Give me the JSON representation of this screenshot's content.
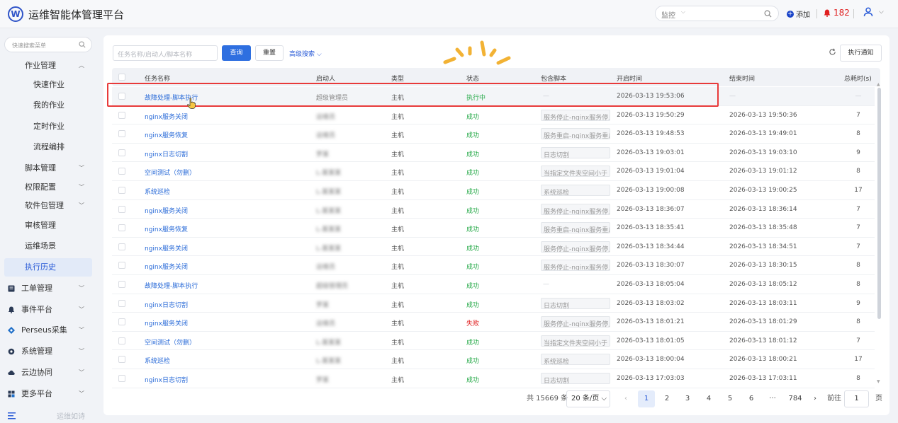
{
  "app": {
    "logo": "W",
    "title": "运维智能体管理平台"
  },
  "topbar": {
    "monitor_select": "监控",
    "search_placeholder": "",
    "add_label": "添加",
    "alarm_count": "182"
  },
  "sidebar": {
    "search_placeholder": "快速搜索菜单",
    "items": [
      {
        "label": "作业管理",
        "arrow": "^"
      },
      {
        "label": "快速作业"
      },
      {
        "label": "我的作业"
      },
      {
        "label": "定时作业"
      },
      {
        "label": "流程编排"
      },
      {
        "label": "脚本管理",
        "arrow": "v"
      },
      {
        "label": "权限配置",
        "arrow": "v"
      },
      {
        "label": "软件包管理",
        "arrow": "v"
      },
      {
        "label": "审核管理"
      },
      {
        "label": "运维场景"
      },
      {
        "label": "执行历史"
      },
      {
        "label": "工单管理",
        "arrow": "v"
      },
      {
        "label": "事件平台",
        "arrow": "v"
      },
      {
        "label": "Perseus采集",
        "arrow": "v"
      },
      {
        "label": "系统管理",
        "arrow": "v"
      },
      {
        "label": "云边协同",
        "arrow": "v"
      },
      {
        "label": "更多平台",
        "arrow": "v"
      }
    ],
    "footer_text": "运维如诗"
  },
  "filter": {
    "input_placeholder": "任务名称/启动人/脚本名称",
    "query_label": "查询",
    "reset_label": "重置",
    "advanced_label": "高级搜索",
    "notify_label": "执行通知"
  },
  "table": {
    "columns": [
      "任务名称",
      "启动人",
      "类型",
      "状态",
      "包含脚本",
      "开启时间",
      "结束时间",
      "总耗时(s)"
    ],
    "rows": [
      {
        "name": "故障处理-脚本执行",
        "starter": "超级管理员",
        "blur": false,
        "type": "主机",
        "status": "执行中",
        "status_color": "#22a845",
        "script": "—",
        "start": "2026-03-13 19:53:06",
        "end": "—",
        "dur": "—"
      },
      {
        "name": "nginx服务关闭",
        "starter": "运维员",
        "blur": true,
        "type": "主机",
        "status": "成功",
        "status_color": "#22a845",
        "script": "服务停止-nginx服务停止",
        "start": "2026-03-13 19:50:29",
        "end": "2026-03-13 19:50:36",
        "dur": "7"
      },
      {
        "name": "nginx服务恢复",
        "starter": "运维员",
        "blur": true,
        "type": "主机",
        "status": "成功",
        "status_color": "#22a845",
        "script": "服务重启-nginx服务重启",
        "start": "2026-03-13 19:48:53",
        "end": "2026-03-13 19:49:01",
        "dur": "8"
      },
      {
        "name": "nginx日志切割",
        "starter": "罗某",
        "blur": true,
        "type": "主机",
        "status": "成功",
        "status_color": "#22a845",
        "script": "日志切割",
        "start": "2026-03-13 19:03:01",
        "end": "2026-03-13 19:03:10",
        "dur": "9"
      },
      {
        "name": "空间测试（勿删）",
        "starter": "L-某某某",
        "blur": true,
        "type": "主机",
        "status": "成功",
        "status_color": "#22a845",
        "script": "当指定文件夹空间小于",
        "start": "2026-03-13 19:01:04",
        "end": "2026-03-13 19:01:12",
        "dur": "8"
      },
      {
        "name": "系统巡检",
        "starter": "L-某某某",
        "blur": true,
        "type": "主机",
        "status": "成功",
        "status_color": "#22a845",
        "script": "系统巡检",
        "start": "2026-03-13 19:00:08",
        "end": "2026-03-13 19:00:25",
        "dur": "17"
      },
      {
        "name": "nginx服务关闭",
        "starter": "L-某某某",
        "blur": true,
        "type": "主机",
        "status": "成功",
        "status_color": "#22a845",
        "script": "服务停止-nginx服务停止",
        "start": "2026-03-13 18:36:07",
        "end": "2026-03-13 18:36:14",
        "dur": "7"
      },
      {
        "name": "nginx服务恢复",
        "starter": "L-某某某",
        "blur": true,
        "type": "主机",
        "status": "成功",
        "status_color": "#22a845",
        "script": "服务重启-nginx服务重启",
        "start": "2026-03-13 18:35:41",
        "end": "2026-03-13 18:35:48",
        "dur": "7"
      },
      {
        "name": "nginx服务关闭",
        "starter": "L-某某某",
        "blur": true,
        "type": "主机",
        "status": "成功",
        "status_color": "#22a845",
        "script": "服务停止-nginx服务停止",
        "start": "2026-03-13 18:34:44",
        "end": "2026-03-13 18:34:51",
        "dur": "7"
      },
      {
        "name": "nginx服务关闭",
        "starter": "运维员",
        "blur": true,
        "type": "主机",
        "status": "成功",
        "status_color": "#22a845",
        "script": "服务停止-nginx服务停止",
        "start": "2026-03-13 18:30:07",
        "end": "2026-03-13 18:30:15",
        "dur": "8"
      },
      {
        "name": "故障处理-脚本执行",
        "starter": "超级管理员",
        "blur": true,
        "type": "主机",
        "status": "成功",
        "status_color": "#22a845",
        "script": "—",
        "start": "2026-03-13 18:05:04",
        "end": "2026-03-13 18:05:12",
        "dur": "8"
      },
      {
        "name": "nginx日志切割",
        "starter": "罗某",
        "blur": true,
        "type": "主机",
        "status": "成功",
        "status_color": "#22a845",
        "script": "日志切割",
        "start": "2026-03-13 18:03:02",
        "end": "2026-03-13 18:03:11",
        "dur": "9"
      },
      {
        "name": "nginx服务关闭",
        "starter": "运维员",
        "blur": true,
        "type": "主机",
        "status": "失败",
        "status_color": "#e02020",
        "script": "服务停止-nginx服务停止",
        "start": "2026-03-13 18:01:21",
        "end": "2026-03-13 18:01:29",
        "dur": "8"
      },
      {
        "name": "空间测试（勿删）",
        "starter": "L-某某某",
        "blur": true,
        "type": "主机",
        "status": "成功",
        "status_color": "#22a845",
        "script": "当指定文件夹空间小于",
        "start": "2026-03-13 18:01:05",
        "end": "2026-03-13 18:01:12",
        "dur": "7"
      },
      {
        "name": "系统巡检",
        "starter": "L-某某某",
        "blur": true,
        "type": "主机",
        "status": "成功",
        "status_color": "#22a845",
        "script": "系统巡检",
        "start": "2026-03-13 18:00:04",
        "end": "2026-03-13 18:00:21",
        "dur": "17"
      },
      {
        "name": "nginx日志切割",
        "starter": "罗某",
        "blur": true,
        "type": "主机",
        "status": "成功",
        "status_color": "#22a845",
        "script": "日志切割",
        "start": "2026-03-13 17:03:03",
        "end": "2026-03-13 17:03:11",
        "dur": "8"
      }
    ]
  },
  "pagination": {
    "total": "共 15669 条",
    "page_size": "20 条/页",
    "pages": [
      "1",
      "2",
      "3",
      "4",
      "5",
      "6",
      "···",
      "784"
    ],
    "goto_label": "前往",
    "goto_value": "1",
    "page_unit": "页"
  },
  "colors": {
    "accent": "#2e6fe0",
    "link": "#2a6bd8",
    "success": "#22a845",
    "fail": "#e02020",
    "highlight_box": "#e83a3a"
  }
}
